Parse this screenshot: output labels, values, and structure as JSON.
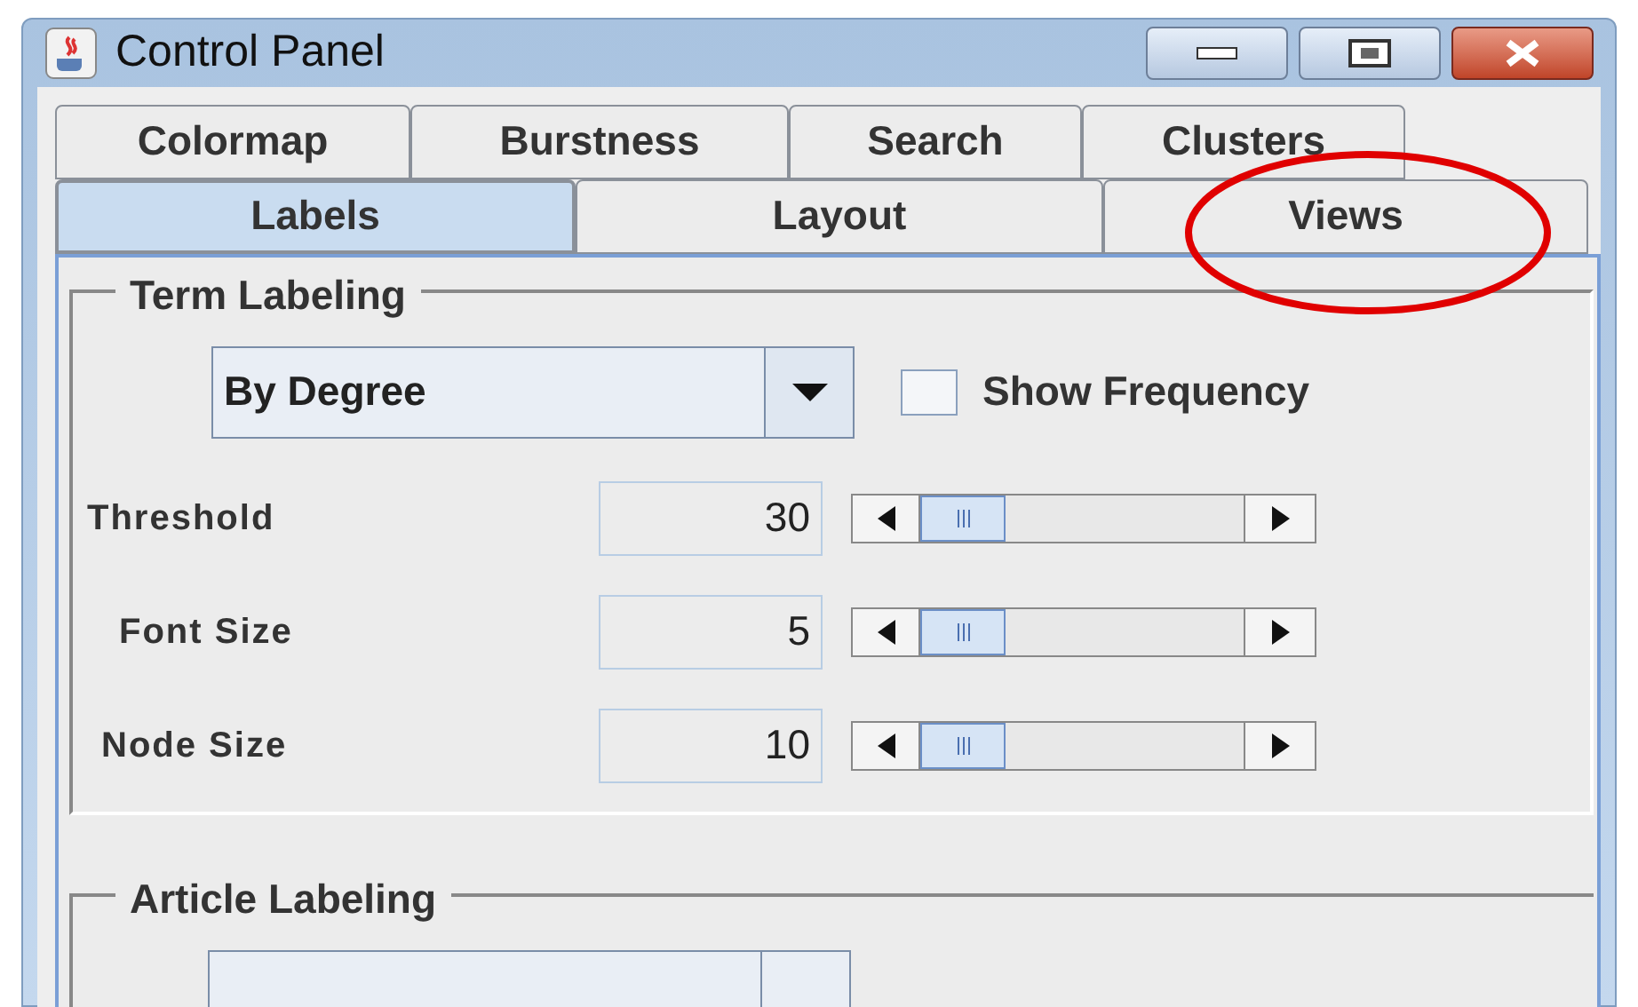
{
  "window": {
    "title": "Control Panel"
  },
  "tab_rows": [
    [
      {
        "label": "Colormap",
        "selected": false
      },
      {
        "label": "Burstness",
        "selected": false
      },
      {
        "label": "Search",
        "selected": false
      },
      {
        "label": "Clusters",
        "selected": false
      }
    ],
    [
      {
        "label": "Labels",
        "selected": true
      },
      {
        "label": "Layout",
        "selected": false
      },
      {
        "label": "Views",
        "selected": false
      }
    ]
  ],
  "term_labeling": {
    "title": "Term Labeling",
    "mode": "By Degree",
    "show_frequency": {
      "label": "Show Frequency",
      "checked": false
    },
    "rows": [
      {
        "label": "Threshold",
        "value": "30"
      },
      {
        "label": "Font Size",
        "value": "5"
      },
      {
        "label": "Node Size",
        "value": "10"
      }
    ]
  },
  "article_labeling": {
    "title": "Article Labeling"
  },
  "annotation": {
    "kind": "ellipse"
  }
}
